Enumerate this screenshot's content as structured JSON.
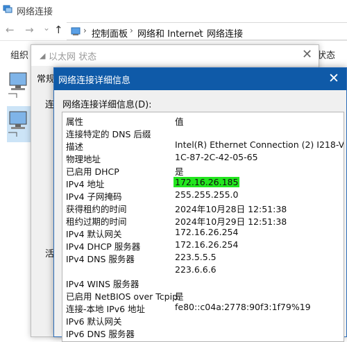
{
  "explorer": {
    "title": "网络连接",
    "nav": {
      "back": "←",
      "forward": "→",
      "dropdown": "⌄",
      "up": "↑"
    },
    "breadcrumb": [
      "控制面板",
      "网络和 Internet",
      "网络连接"
    ],
    "organize_label": "组织",
    "right_label": "状态"
  },
  "status_dialog": {
    "title": "以太网 状态",
    "tab_general": "常规",
    "connection_label": "连",
    "activity_label": "活"
  },
  "details_dialog": {
    "title": "网络连接详细信息",
    "list_label": "网络连接详细信息(D):",
    "header": {
      "property": "属性",
      "value": "值"
    },
    "rows": [
      {
        "property": "连接特定的 DNS 后缀",
        "value": ""
      },
      {
        "property": "描述",
        "value": "Intel(R) Ethernet Connection (2) I218-V"
      },
      {
        "property": "物理地址",
        "value": "1C-87-2C-42-05-65"
      },
      {
        "property": "已启用 DHCP",
        "value": "是"
      },
      {
        "property": "IPv4 地址",
        "value": "172.16.26.185",
        "highlighted": true
      },
      {
        "property": "IPv4 子网掩码",
        "value": "255.255.255.0"
      },
      {
        "property": "获得租约的时间",
        "value": "2024年10月28日 12:51:38"
      },
      {
        "property": "租约过期的时间",
        "value": "2024年10月29日 12:51:38"
      },
      {
        "property": "IPv4 默认网关",
        "value": "172.16.26.254"
      },
      {
        "property": "IPv4 DHCP 服务器",
        "value": "172.16.26.254"
      },
      {
        "property": "IPv4 DNS 服务器",
        "value": "223.5.5.5"
      },
      {
        "property": "",
        "value": "223.6.6.6"
      },
      {
        "property": "IPv4 WINS 服务器",
        "value": ""
      },
      {
        "property": "已启用 NetBIOS over Tcpip",
        "value": "是"
      },
      {
        "property": "连接-本地 IPv6 地址",
        "value": "fe80::c04a:2778:90f3:1f79%19"
      },
      {
        "property": "IPv6 默认网关",
        "value": ""
      },
      {
        "property": "IPv6 DNS 服务器",
        "value": ""
      }
    ],
    "highlight_color": "#22e61e",
    "title_bar_color": "#0f5aa8"
  }
}
